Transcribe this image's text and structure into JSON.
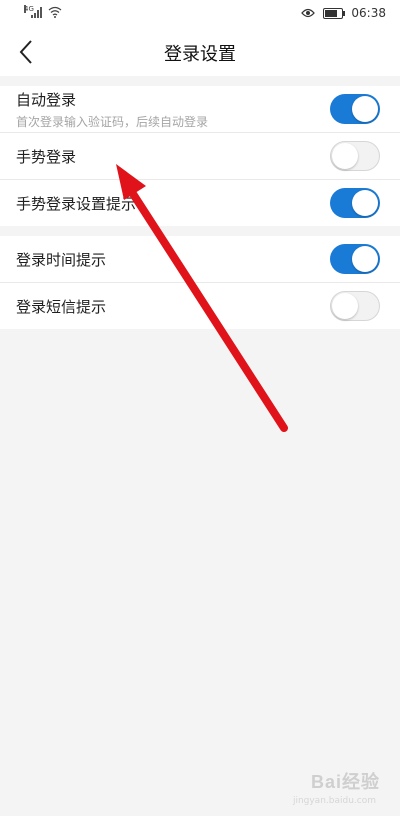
{
  "status_bar": {
    "network_label": "4G",
    "time": "06:38",
    "battery_level": 0.7
  },
  "header": {
    "title": "登录设置",
    "back_icon": "chevron-left-icon"
  },
  "groups": [
    {
      "items": [
        {
          "label": "自动登录",
          "subtitle": "首次登录输入验证码，后续自动登录",
          "on": true
        },
        {
          "label": "手势登录",
          "on": false
        },
        {
          "label": "手势登录设置提示",
          "on": true
        }
      ]
    },
    {
      "items": [
        {
          "label": "登录时间提示",
          "on": true
        },
        {
          "label": "登录短信提示",
          "on": false
        }
      ]
    }
  ],
  "colors": {
    "toggle_on": "#1a7bd6",
    "toggle_off": "#f2f2f2",
    "arrow": "#e0131b",
    "background": "#f4f4f4"
  },
  "watermark": {
    "text": "Bai经验",
    "url": "jingyan.baidu.com"
  }
}
